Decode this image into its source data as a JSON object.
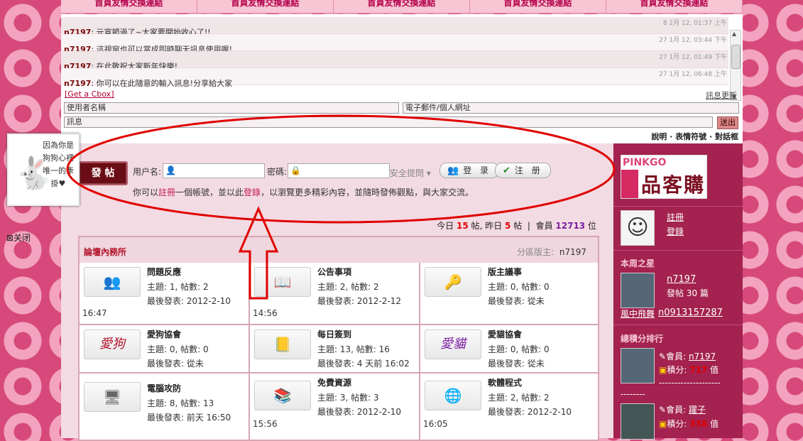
{
  "top_links": [
    "首頁友情交換連結",
    "首頁友情交換連結",
    "首頁友情交換連結",
    "首頁友情交換連結",
    "首頁友情交換連結"
  ],
  "cbox": {
    "messages": [
      {
        "time": "8 2月 12, 01:37 上午",
        "nick": "n7197",
        "text": ": 元宵節過了~大家要開始收心了!!"
      },
      {
        "time": "27 1月 12, 03:44 下午",
        "nick": "n7197",
        "text": ": 這視窗也可以當成即時聊天訊息使用喔!"
      },
      {
        "time": "27 1月 12, 01:49 下午",
        "nick": "n7197",
        "text": ": 在此敬祝大家新年快樂!"
      },
      {
        "time": "27 1月 12, 06:48 上午",
        "nick": "n7197",
        "text": ": 你可以在此隨意的輸入訊息!分享給大家"
      }
    ],
    "get_cbox": "[Get a Cbox]",
    "refresh": "訊息更新",
    "name_placeholder": "使用者名稱",
    "url_placeholder": "電子郵件/個人網址",
    "msg_placeholder": "訊息",
    "send": "送出",
    "footer": "說明 · 表情符號 · 對話框"
  },
  "login": {
    "post_button": "發 帖",
    "username_label": "用户名:",
    "password_label": "密碼:",
    "security_q": "安全提問 ▾",
    "login_button": "登 录",
    "register_button": "注 册",
    "hint_prefix": "你可以",
    "hint_reg": "註冊",
    "hint_mid": "一個帳號，並以此",
    "hint_login": "登錄",
    "hint_suffix": "，以瀏覽更多精彩內容，並隨時發佈觀點，與大家交流。"
  },
  "stats": {
    "today_label": "今日",
    "today": "15",
    "post_unit": "帖",
    "yesterday_label": "昨日",
    "yesterday": "5",
    "post_unit2": "帖",
    "members_label": "會員",
    "members": "12713",
    "members_unit": "位"
  },
  "forum": {
    "title": "論壇內務所",
    "mod_label": "分區版主:",
    "mod_name": "n7197",
    "boards": [
      {
        "title": "問題反應",
        "meta1": "主題: 1, 帖數: 2",
        "meta2": "最後發表: 2012-2-10",
        "time": "16:47",
        "icon": "people-icon",
        "glyph": "👥"
      },
      {
        "title": "公告事項",
        "meta1": "主題: 2, 帖數: 2",
        "meta2": "最後發表: 2012-2-12",
        "time": "14:56",
        "icon": "notebook-icon",
        "glyph": "📖"
      },
      {
        "title": "版主議事",
        "meta1": "主題: 0, 帖數: 0",
        "meta2": "最後發表: 從未",
        "time": "",
        "icon": "keys-icon",
        "glyph": "🔑"
      },
      {
        "title": "愛狗協會",
        "meta1": "主題: 0, 帖數: 0",
        "meta2": "最後發表: 從未",
        "time": "",
        "icon": "dog-text-icon",
        "glyph": "愛狗"
      },
      {
        "title": "每日簽到",
        "meta1": "主題: 13, 帖數: 16",
        "meta2": "最後發表: 4 天前 16:02",
        "time": "",
        "icon": "planner-icon",
        "glyph": "📒"
      },
      {
        "title": "愛貓協會",
        "meta1": "主題: 0, 帖數: 0",
        "meta2": "最後發表: 從未",
        "time": "",
        "icon": "cat-text-icon",
        "glyph": "愛貓"
      },
      {
        "title": "電腦攻防",
        "meta1": "主題: 8, 帖數: 13",
        "meta2": "最後發表: 前天 16:50",
        "time": "",
        "icon": "computer-icon",
        "glyph": "🖥"
      },
      {
        "title": "免費資源",
        "meta1": "主題: 3, 帖數: 3",
        "meta2": "最後發表: 2012-2-10",
        "time": "15:56",
        "icon": "books-icon",
        "glyph": "📚"
      },
      {
        "title": "軟體程式",
        "meta1": "主題: 2, 帖數: 2",
        "meta2": "最後發表: 2012-2-10",
        "time": "16:05",
        "icon": "globe-icon",
        "glyph": "🌐"
      }
    ]
  },
  "sidebar": {
    "logo_top": "PINKGO",
    "logo_main": "品客購",
    "register": "註冊",
    "login": "登錄",
    "star_heading": "本周之星",
    "star_name": "n7197",
    "star_posts": "發帖 30 篇",
    "star_user_a": "風中飛舞",
    "star_user_b": "n0913157287",
    "rank_heading": "總積分排行",
    "rank": [
      {
        "member_label": "會員:",
        "member": "n7197",
        "score_label": "積分:",
        "score": "717",
        "unit": "值"
      },
      {
        "member_label": "會員:",
        "member": "躍子",
        "score_label": "積分:",
        "score": "338",
        "unit": "值"
      }
    ],
    "dashes": "--------------------"
  },
  "ad": {
    "text": "因為你是狗狗心裡唯一的牽掛♥",
    "close": "⊠关闭"
  },
  "colors": {
    "accent": "#b3132a",
    "highlight": "#e00000",
    "members": "#7b1fa2"
  }
}
